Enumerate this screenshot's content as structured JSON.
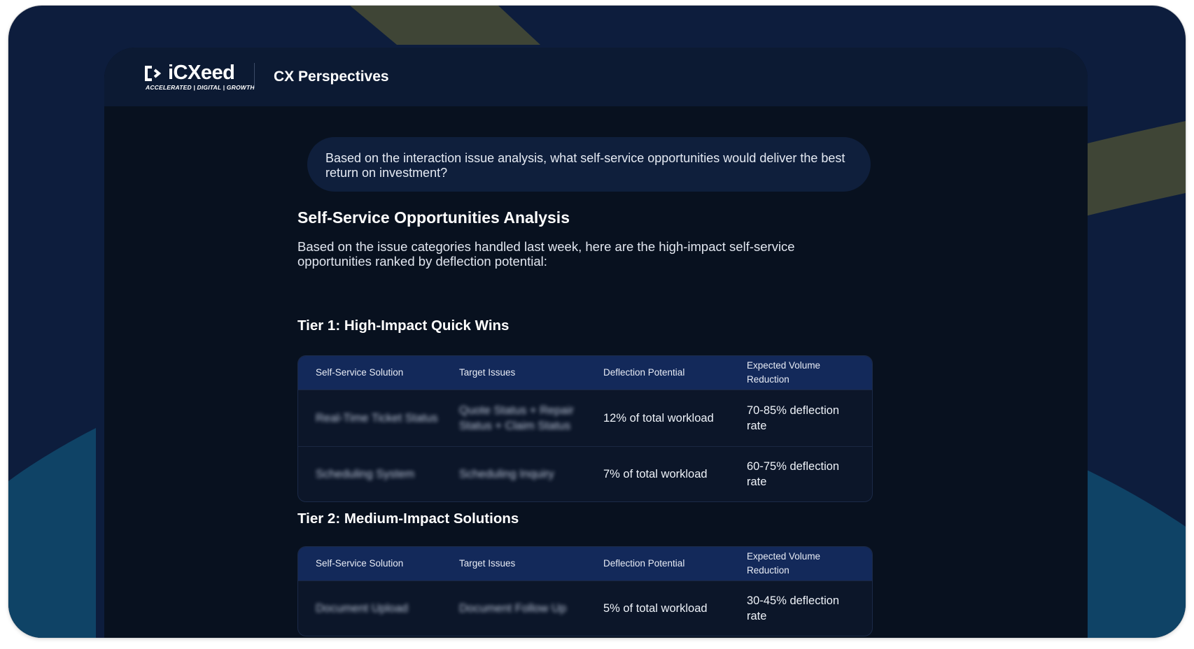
{
  "brand": {
    "logo_name": "iCXeed",
    "logo_tagline": "ACCELERATED | DIGITAL | GROWTH",
    "logo_icon": "icxeed-mark-icon"
  },
  "header": {
    "title": "CX Perspectives"
  },
  "colors": {
    "outer_background": "#0d1d3d",
    "app_background": "#08111f",
    "header_background": "#0c1a33",
    "table_header": "#13295a",
    "question_bubble": "#0f1f3c",
    "accent_olive": "#3f4536",
    "accent_teal": "#0f4366"
  },
  "conversation": {
    "question": "Based on the interaction issue analysis, what self-service opportunities would deliver the best return on investment?",
    "answer": {
      "heading": "Self-Service Opportunities Analysis",
      "intro": "Based on the issue categories handled last week, here are the high-impact self-service opportunities ranked by deflection potential:",
      "tier1": {
        "heading": "Tier 1: High-Impact Quick Wins",
        "columns": [
          "Self-Service Solution",
          "Target Issues",
          "Deflection Potential",
          "Expected Volume Reduction"
        ],
        "rows": [
          {
            "solution": "Real-Time Ticket Status",
            "issues": "Quote Status + Repair Status + Claim Status",
            "deflection": "12% of total workload",
            "reduction": "70-85% deflection rate"
          },
          {
            "solution": "Scheduling System",
            "issues": "Scheduling Inquiry",
            "deflection": "7% of total workload",
            "reduction": "60-75% deflection rate"
          }
        ]
      },
      "tier2": {
        "heading": "Tier 2: Medium-Impact Solutions",
        "columns": [
          "Self-Service Solution",
          "Target Issues",
          "Deflection Potential",
          "Expected Volume Reduction"
        ],
        "rows": [
          {
            "solution": "Document Upload",
            "issues": "Document Follow Up",
            "deflection": "5% of total workload",
            "reduction": "30-45% deflection rate"
          }
        ]
      }
    }
  }
}
